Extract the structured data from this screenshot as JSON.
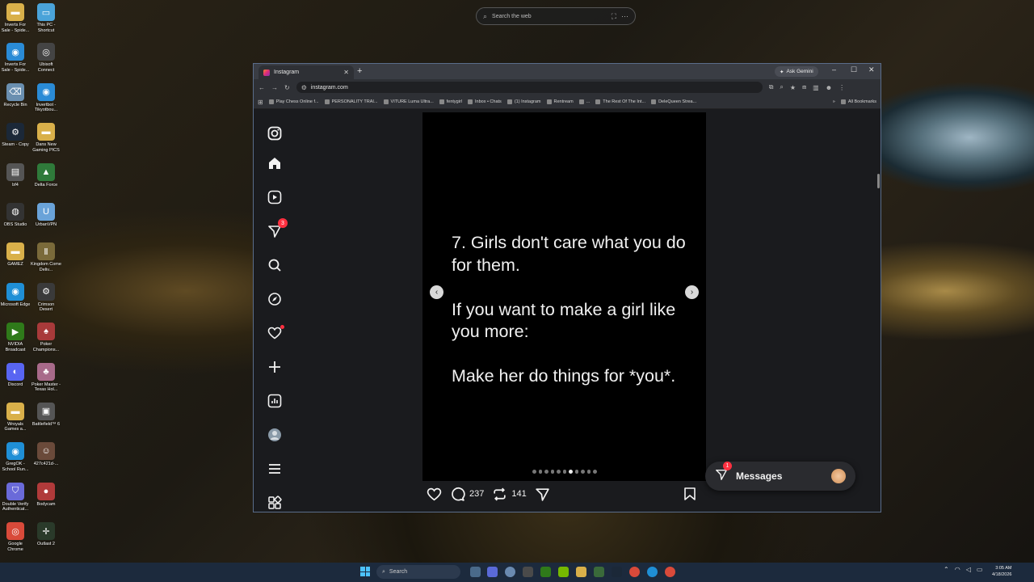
{
  "desktop": {
    "search_placeholder": "Search the web",
    "icons": [
      {
        "label": "Inverts For Sale - Spide...",
        "color": "#d9b04a",
        "glyph": "▬"
      },
      {
        "label": "This PC - Shortcut",
        "color": "#4aa3d9",
        "glyph": "▭"
      },
      {
        "label": "Inverts For Sale - Spide...",
        "color": "#2a8bd6",
        "glyph": "◉"
      },
      {
        "label": "Ubisoft Connect",
        "color": "#444",
        "glyph": "◎"
      },
      {
        "label": "Recycle Bin",
        "color": "#6a8fb0",
        "glyph": "⌫"
      },
      {
        "label": "Invertbot - Tikyotbou...",
        "color": "#2a8bd6",
        "glyph": "◉"
      },
      {
        "label": "Steam - Copy",
        "color": "#1b2838",
        "glyph": "⚙"
      },
      {
        "label": "Dans New Gaming PICS",
        "color": "#d9b04a",
        "glyph": "▬"
      },
      {
        "label": "bf4",
        "color": "#555",
        "glyph": "▤"
      },
      {
        "label": "Delta Force",
        "color": "#2f7a3a",
        "glyph": "▲"
      },
      {
        "label": "OBS Studio",
        "color": "#333",
        "glyph": "◍"
      },
      {
        "label": "UrbanVPN",
        "color": "#6aa3d9",
        "glyph": "U"
      },
      {
        "label": "GAMEZ",
        "color": "#d9b04a",
        "glyph": "▬"
      },
      {
        "label": "Kingdom Come Deliv...",
        "color": "#7a6a3a",
        "glyph": "Ⅱ"
      },
      {
        "label": "Microsoft Edge",
        "color": "#1f8fd6",
        "glyph": "◉"
      },
      {
        "label": "Crimson Desert",
        "color": "#3a3a3a",
        "glyph": "⚙"
      },
      {
        "label": "NVIDIA Broadcast",
        "color": "#2f7a1a",
        "glyph": "▶"
      },
      {
        "label": "Poker Champions...",
        "color": "#a83a3a",
        "glyph": "♠"
      },
      {
        "label": "Discord",
        "color": "#5865f2",
        "glyph": "◐"
      },
      {
        "label": "Poker Master - Texas Hol...",
        "color": "#a86a8a",
        "glyph": "♣"
      },
      {
        "label": "Wroyals Games a...",
        "color": "#d9b04a",
        "glyph": "▬"
      },
      {
        "label": "Battlefield™ 6",
        "color": "#555",
        "glyph": "▣"
      },
      {
        "label": "GregOK - School Run...",
        "color": "#1f8fd6",
        "glyph": "◉"
      },
      {
        "label": "427c421d-...",
        "color": "#6a4a3a",
        "glyph": "☺"
      },
      {
        "label": "Double Verify Authenticat...",
        "color": "#6a6ad9",
        "glyph": "⛉"
      },
      {
        "label": "Bodycam",
        "color": "#b03a3a",
        "glyph": "●"
      },
      {
        "label": "Google Chrome",
        "color": "#d94a3a",
        "glyph": "◎"
      },
      {
        "label": "Outlast 2",
        "color": "#2a3a2a",
        "glyph": "✛"
      }
    ]
  },
  "browser": {
    "tab_title": "Instagram",
    "new_tab_icon": "+",
    "ask_gemini": "Ask Gemini",
    "url": "instagram.com",
    "bookmarks": [
      "Play Chess Online f...",
      "PERSONALITY TRAI...",
      "VITURE Luma Ultra...",
      "fentygirl",
      "Inbox • Chats",
      "(1) Instagram",
      "Rentream",
      "...",
      "The Rest Of The Int...",
      "DeleQueen Strea..."
    ],
    "all_bookmarks": "All Bookmarks"
  },
  "instagram": {
    "nav_notifications_badge": "3",
    "post_text": "7. Girls don't care what you do for them.\n\nIf you want to make a girl like you more:\n\nMake her do things for *you*.",
    "comments_count": "237",
    "reposts_count": "141",
    "carousel_total": 11,
    "carousel_active_index": 6,
    "messages_label": "Messages",
    "messages_badge": "1"
  },
  "taskbar": {
    "search_placeholder": "Search",
    "time": "3:05 AM",
    "date": "4/18/2026"
  }
}
